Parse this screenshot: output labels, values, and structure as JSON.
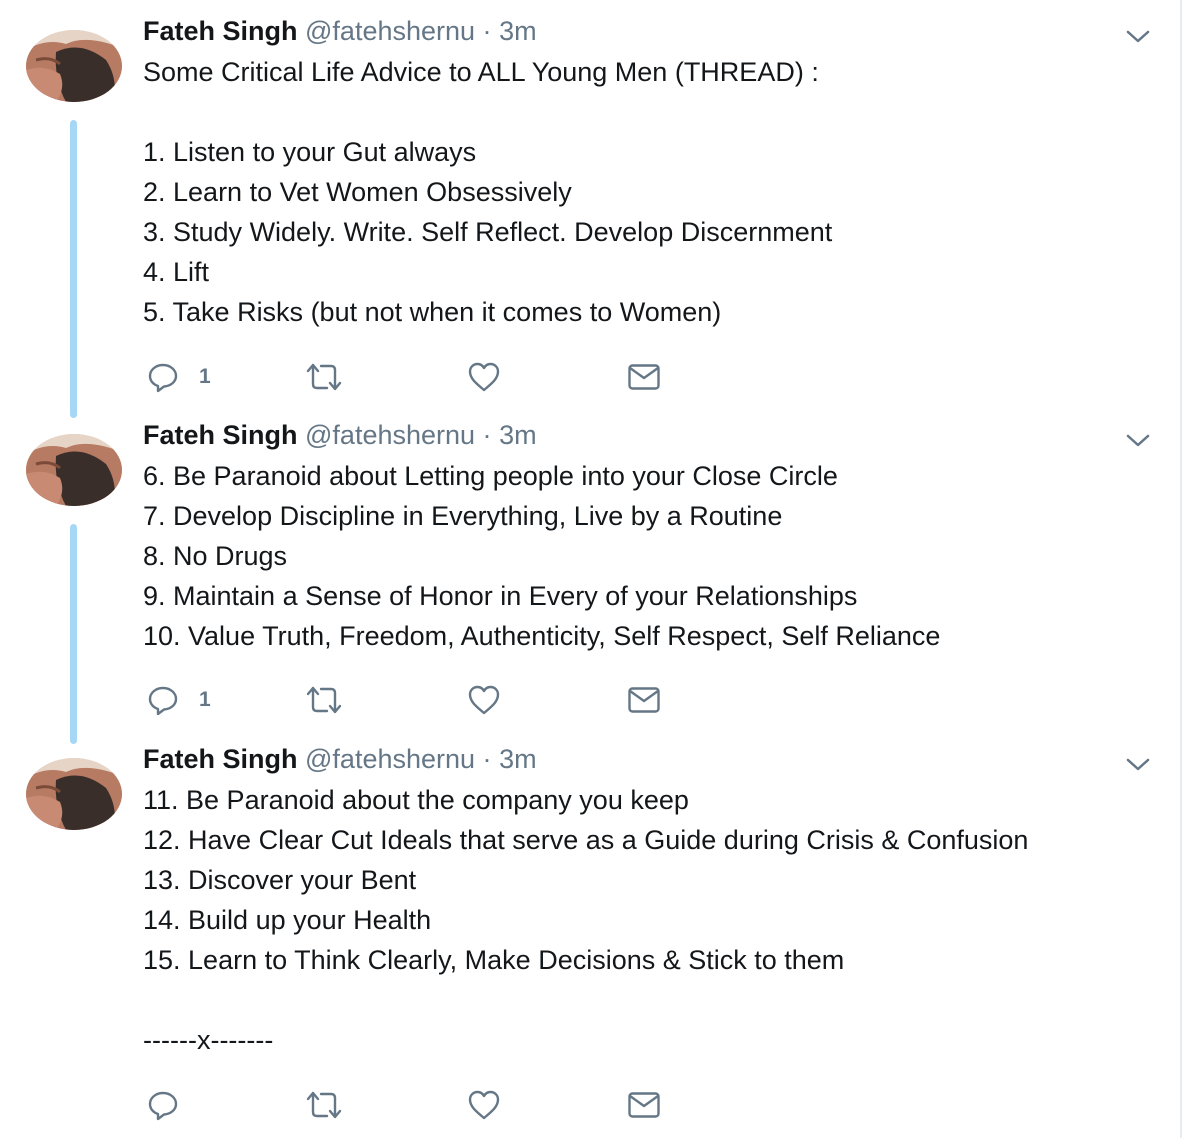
{
  "colors": {
    "thread_line": "#a6d8f5",
    "icon": "#657786",
    "name": "#14171a"
  },
  "tweets": [
    {
      "name": "Fateh Singh",
      "handle": "@fatehshernu",
      "separator": "·",
      "time": "3m",
      "lines": [
        "Some Critical Life Advice to ALL Young Men (THREAD) :",
        "",
        "1. Listen to your Gut always",
        "2. Learn to Vet Women Obsessively",
        "3. Study Widely. Write. Self Reflect. Develop Discernment",
        "4. Lift",
        "5. Take Risks (but not when it comes to Women)"
      ],
      "reply_count": "1"
    },
    {
      "name": "Fateh Singh",
      "handle": "@fatehshernu",
      "separator": "·",
      "time": "3m",
      "lines": [
        "6. Be Paranoid about Letting people into your Close Circle",
        "7. Develop Discipline in Everything, Live by a Routine",
        "8. No Drugs",
        "9. Maintain a Sense of Honor in Every of your Relationships",
        "10. Value Truth, Freedom, Authenticity, Self Respect, Self Reliance"
      ],
      "reply_count": "1"
    },
    {
      "name": "Fateh Singh",
      "handle": "@fatehshernu",
      "separator": "·",
      "time": "3m",
      "lines": [
        "11. Be Paranoid about the company you keep",
        "12. Have Clear Cut Ideals that serve as a Guide during Crisis & Confusion",
        "13. Discover your Bent",
        "14. Build up your Health",
        "15. Learn to Think Clearly, Make Decisions & Stick to them",
        "",
        "------x-------"
      ],
      "reply_count": ""
    }
  ],
  "icons": {
    "reply": "reply-icon",
    "retweet": "retweet-icon",
    "like": "heart-icon",
    "message": "envelope-icon",
    "caret": "chevron-down-icon"
  }
}
